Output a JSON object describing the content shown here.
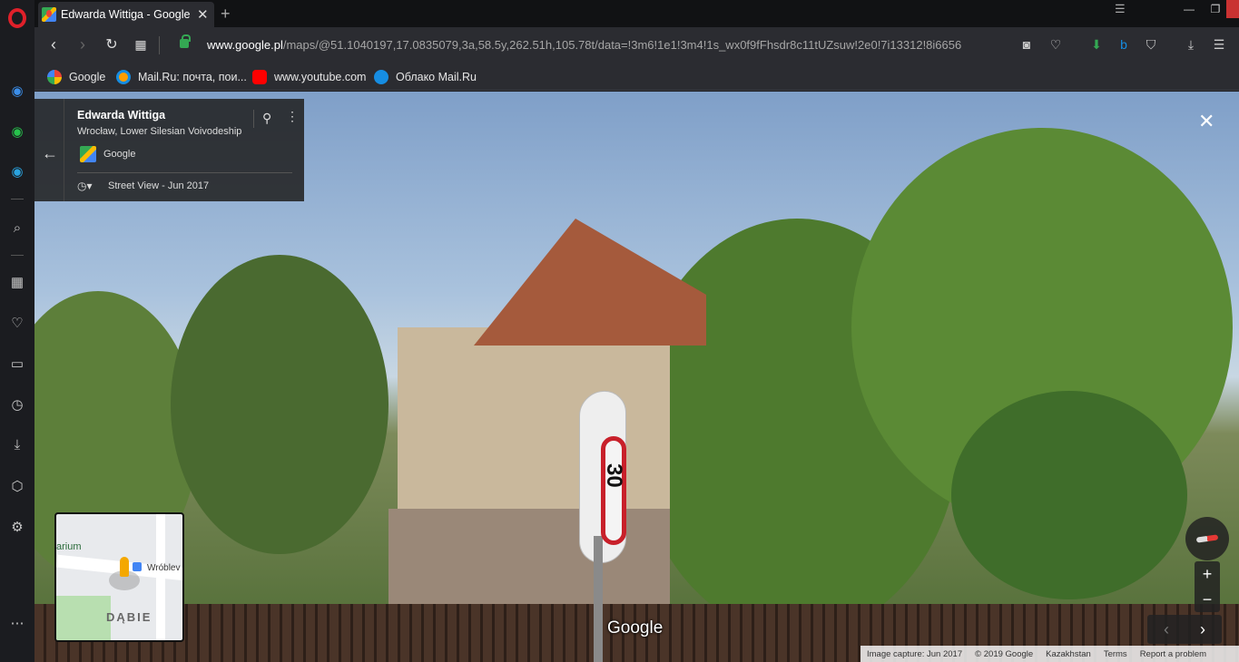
{
  "tab": {
    "title": "Edwarda Wittiga - Google M",
    "favicon": "google-maps-icon"
  },
  "address_bar": {
    "domain": "www.google.pl",
    "path": "/maps/@51.1040197,17.0835079,3a,58.5y,262.51h,105.78t/data=!3m6!1e1!3m4!1s_wx0f9fFhsdr8c11tUZsuw!2e0!7i13312!8i6656"
  },
  "bookmarks": [
    {
      "label": "Google",
      "icon": "google-icon",
      "color": "#4285f4"
    },
    {
      "label": "Mail.Ru: почта, пои...",
      "icon": "mailru-icon",
      "color": "#ff9e00"
    },
    {
      "label": "www.youtube.com",
      "icon": "youtube-icon",
      "color": "#ff0000"
    },
    {
      "label": "Облако Mail.Ru",
      "icon": "cloud-icon",
      "color": "#168de2"
    }
  ],
  "place_card": {
    "title": "Edwarda Wittiga",
    "subtitle": "Wrocław, Lower Silesian Voivodeship",
    "source": "Google",
    "date": "Street View - Jun 2017"
  },
  "minimap": {
    "label_left": "arium",
    "label_street": "Wróblev",
    "label_district": "DĄBIE"
  },
  "sign": {
    "speed": "30"
  },
  "watermark": "Google",
  "footer": {
    "capture": "Image capture: Jun 2017",
    "copyright": "© 2019 Google",
    "region": "Kazakhstan",
    "terms": "Terms",
    "report": "Report a problem"
  },
  "controls": {
    "zoom_in": "+",
    "zoom_out": "−",
    "prev": "‹",
    "next": "›",
    "close": "✕"
  },
  "colors": {
    "opera_red": "#e0202a",
    "accent_green": "#34a853"
  }
}
